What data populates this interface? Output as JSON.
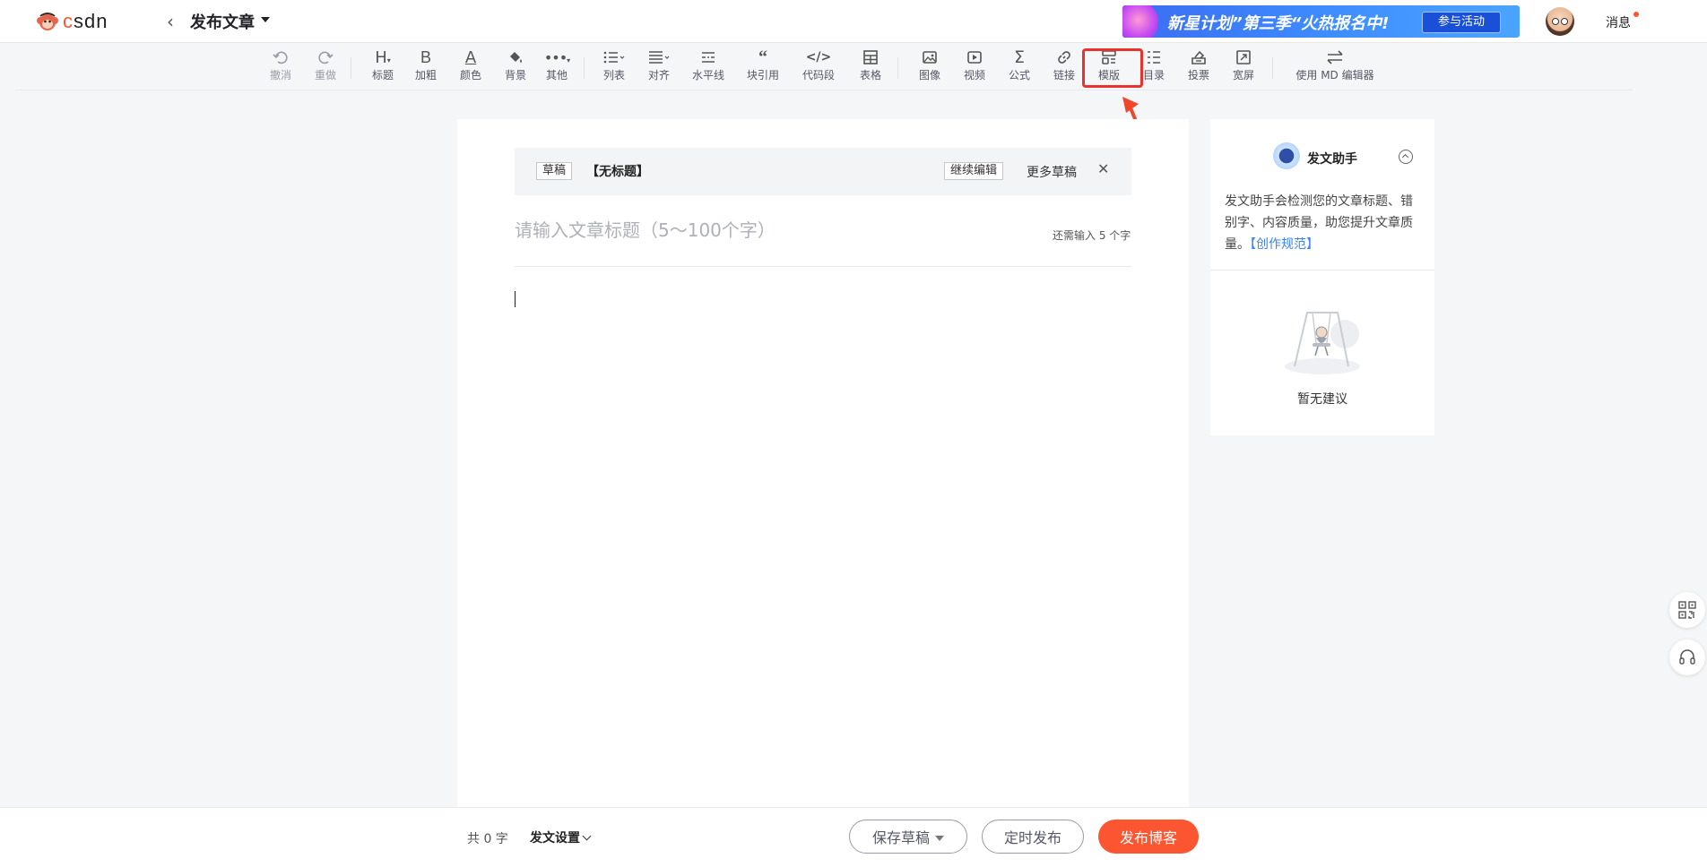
{
  "header": {
    "logo_text": "CSDN",
    "page_title": "发布文章",
    "banner": {
      "text": "新星计划”第三季“火热报名中!",
      "button": "参与活动"
    },
    "messages": "消息"
  },
  "toolbar": {
    "items": [
      {
        "id": "undo",
        "label": "撤消",
        "icon": "undo-icon"
      },
      {
        "id": "redo",
        "label": "重做",
        "icon": "redo-icon"
      },
      {
        "id": "heading",
        "label": "标题",
        "icon": "heading-icon"
      },
      {
        "id": "bold",
        "label": "加粗",
        "icon": "bold-icon"
      },
      {
        "id": "color",
        "label": "颜色",
        "icon": "font-color-icon"
      },
      {
        "id": "background",
        "label": "背景",
        "icon": "paint-bucket-icon"
      },
      {
        "id": "other",
        "label": "其他",
        "icon": "more-dots-icon"
      },
      {
        "id": "list",
        "label": "列表",
        "icon": "list-icon"
      },
      {
        "id": "align",
        "label": "对齐",
        "icon": "align-icon"
      },
      {
        "id": "hr",
        "label": "水平线",
        "icon": "horizontal-rule-icon"
      },
      {
        "id": "quote",
        "label": "块引用",
        "icon": "quote-icon"
      },
      {
        "id": "code",
        "label": "代码段",
        "icon": "code-icon"
      },
      {
        "id": "table",
        "label": "表格",
        "icon": "table-icon"
      },
      {
        "id": "image",
        "label": "图像",
        "icon": "image-icon"
      },
      {
        "id": "video",
        "label": "视频",
        "icon": "video-icon"
      },
      {
        "id": "formula",
        "label": "公式",
        "icon": "sigma-icon"
      },
      {
        "id": "link",
        "label": "链接",
        "icon": "link-icon"
      },
      {
        "id": "template",
        "label": "模版",
        "icon": "template-icon"
      },
      {
        "id": "toc",
        "label": "目录",
        "icon": "toc-icon"
      },
      {
        "id": "vote",
        "label": "投票",
        "icon": "vote-icon"
      },
      {
        "id": "widescreen",
        "label": "宽屏",
        "icon": "widescreen-icon"
      },
      {
        "id": "md",
        "label": "使用 MD 编辑器",
        "icon": "switch-arrows-icon"
      }
    ]
  },
  "editor": {
    "draft_tag": "草稿",
    "draft_name": "【无标题】",
    "continue_edit": "继续编辑",
    "more_drafts": "更多草稿",
    "title_placeholder": "请输入文章标题（5～100个字）",
    "title_hint": "还需输入 5 个字"
  },
  "assistant": {
    "title": "发文助手",
    "description": "发文助手会检测您的文章标题、错别字、内容质量，助您提升文章质量。",
    "link": "【创作规范】",
    "empty_text": "暂无建议"
  },
  "footer": {
    "word_count": "共 0 字",
    "settings": "发文设置",
    "save_draft": "保存草稿",
    "schedule": "定时发布",
    "publish": "发布博客"
  },
  "colors": {
    "brand": "#fc5531",
    "highlight": "#e8322b",
    "link": "#3b83f5"
  }
}
